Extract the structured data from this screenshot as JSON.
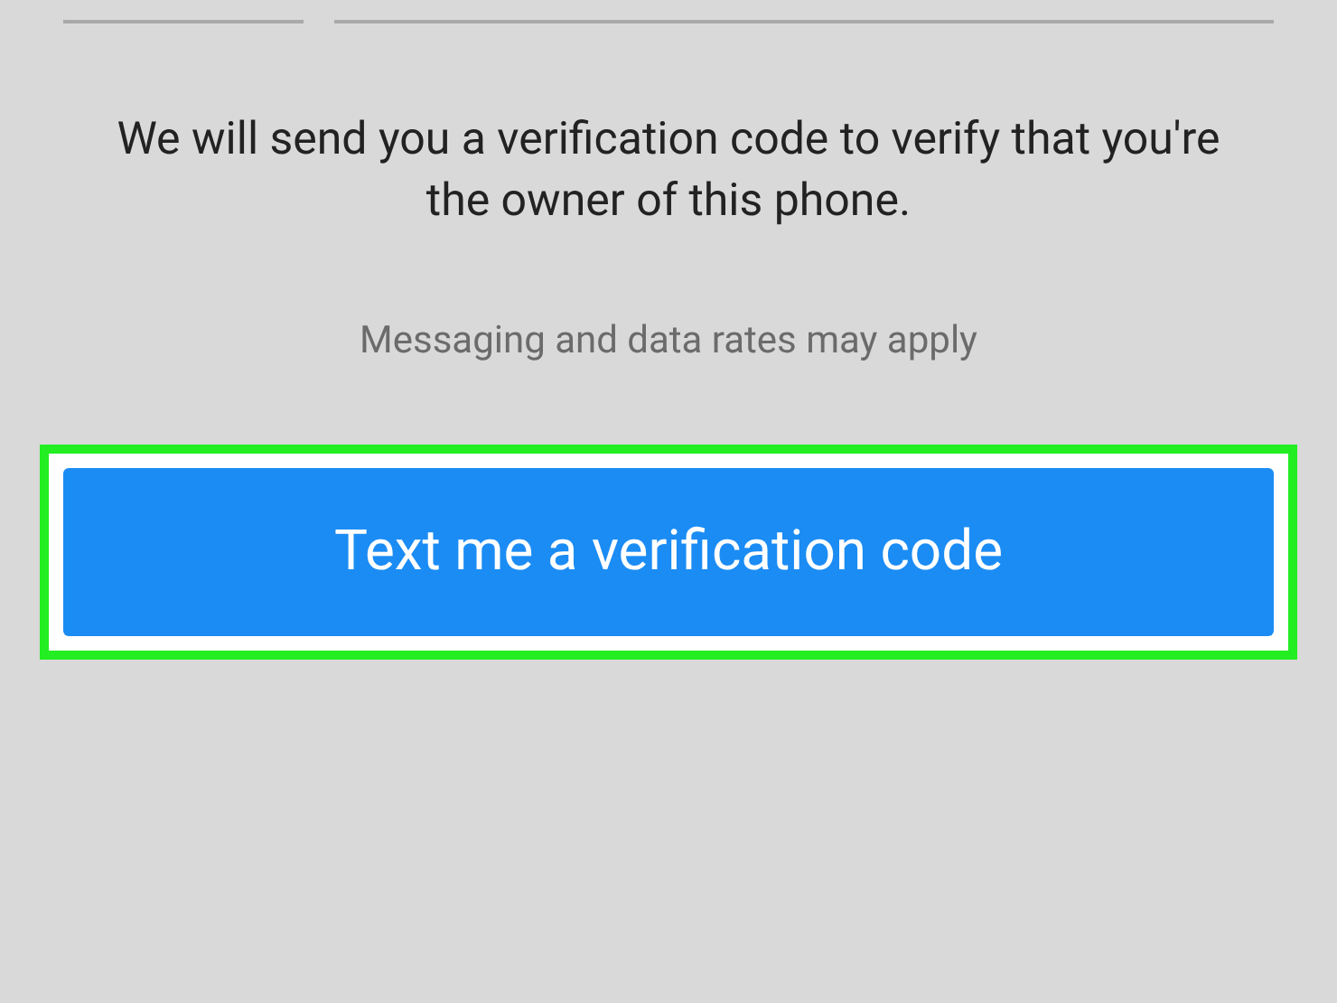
{
  "message": "We will send you a verification code to verify that you're the owner of this phone.",
  "note": "Messaging and data rates may apply",
  "button": {
    "label": "Text me a verification code",
    "highlighted": true
  }
}
